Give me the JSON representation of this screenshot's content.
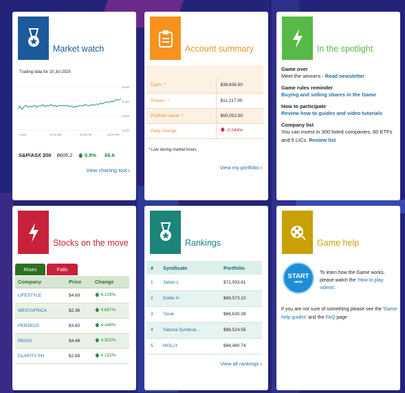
{
  "colors": {
    "market_watch": "#1c5a9b",
    "account_summary": "#f7921e",
    "spotlight": "#57b947",
    "stocks": "#c8213b",
    "rankings": "#1c8478",
    "game_help": "#c9a006"
  },
  "market_watch": {
    "title": "Market watch",
    "icon": "award-ribbon-icon",
    "subtitle": "Trading data for 10 Jul 2025",
    "y_ticks": [
      "8,650",
      "8,600",
      "8,550",
      "8,500"
    ],
    "x_ticks": [
      "10am",
      "12:00 AM",
      "02:00 PM",
      "04:00 PM"
    ],
    "index_name": "S&P/ASX 200",
    "index_value": "8605.2",
    "index_change": "0.8%",
    "index_points": "66.6",
    "link": "View charting tool"
  },
  "account_summary": {
    "title": "Account summary",
    "icon": "clipboard-icon",
    "rows": [
      {
        "label": "Cash: *",
        "value": "$38,836.50"
      },
      {
        "label": "Shares: *",
        "value": "$11,217.00"
      },
      {
        "label": "Portfolio value: *",
        "value": "$50,053.50"
      },
      {
        "label": "Daily change:",
        "value": "-0.044%"
      }
    ],
    "note": "* Live during market hours",
    "link": "View my portfolio"
  },
  "spotlight": {
    "title": "In the spotlight",
    "icon": "lightning-bolt-icon",
    "items": [
      {
        "heading": "Game over",
        "text": "Meet the winners - ",
        "link": "Read newsletter"
      },
      {
        "heading": "Game rules reminder",
        "text": "",
        "link": "Buying and selling shares in the Game"
      },
      {
        "heading": "How to participate",
        "text": "",
        "link": "Review how to guides and video tutorials"
      },
      {
        "heading": "Company list",
        "text": "You can invest in 300 listed companies, 60 ETFs and 5 LICs. ",
        "link": "Review list"
      }
    ]
  },
  "stocks": {
    "title": "Stocks on the move",
    "icon": "lightning-bolt-icon",
    "tabs": [
      "Rises",
      "Falls"
    ],
    "headers": [
      "Company",
      "Price",
      "Change"
    ],
    "rows": [
      {
        "company": "LIFESTYLE",
        "price": "$4.69",
        "change": "6.109%"
      },
      {
        "company": "WESTAFRICA",
        "price": "$2.36",
        "change": "4.667%"
      },
      {
        "company": "PERSEUS",
        "price": "$3.60",
        "change": "4.348%"
      },
      {
        "company": "REGIS",
        "price": "$4.48",
        "change": "4.302%"
      },
      {
        "company": "CLARITY PH",
        "price": "$2.88",
        "change": "4.152%"
      }
    ]
  },
  "rankings": {
    "title": "Rankings",
    "icon": "award-ribbon-icon",
    "headers": [
      "#",
      "Syndicate",
      "Portfolio"
    ],
    "rows": [
      {
        "rank": "1",
        "name": "Jadon L",
        "portfolio": "$71,053.61"
      },
      {
        "rank": "2",
        "name": "Eddie H",
        "portfolio": "$69,573.10"
      },
      {
        "rank": "3",
        "name": "7pvar",
        "portfolio": "$68,630.39"
      },
      {
        "rank": "4",
        "name": "Yakuza Syndicat...",
        "portfolio": "$68,524.55"
      },
      {
        "rank": "5",
        "name": "MOLLY",
        "portfolio": "$68,480.74"
      }
    ],
    "link": "View all rankings"
  },
  "game_help": {
    "title": "Game help",
    "icon": "film-reel-icon",
    "start_line1": "START",
    "start_line2": "HERE",
    "text1_a": "To learn how the Game works, please watch the ",
    "text1_link": "'How to play videos'",
    "text1_b": ".",
    "text2_a": "If you are not sure of something please see the ",
    "text2_link1": "'Game help guides'",
    "text2_b": " and the ",
    "text2_link2": "FAQ",
    "text2_c": " page"
  }
}
